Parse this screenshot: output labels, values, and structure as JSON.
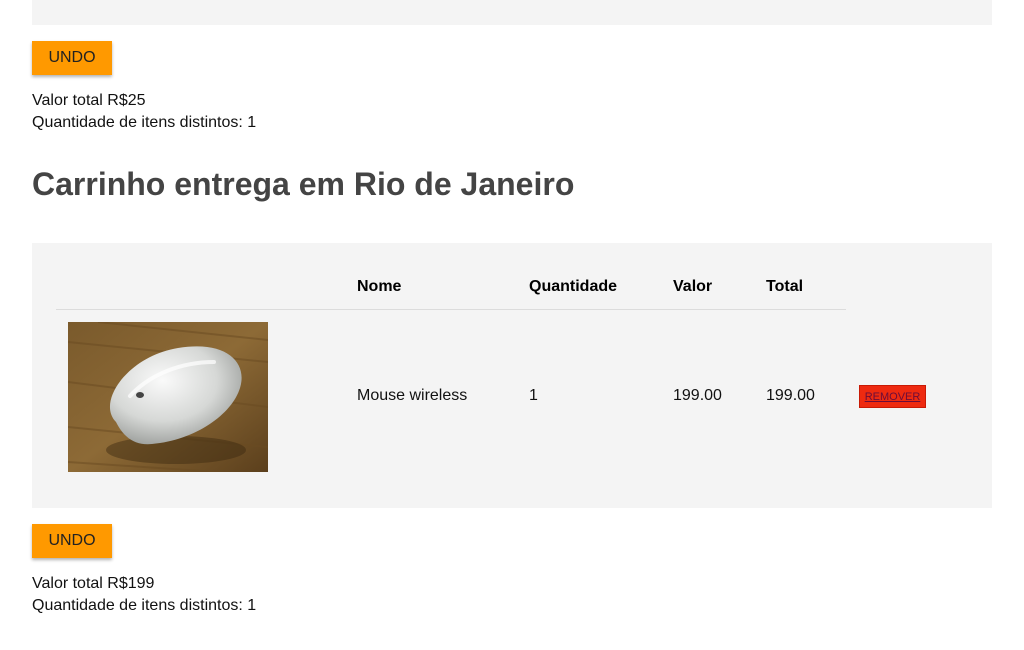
{
  "section_prev": {
    "undo_label": "UNDO",
    "total_line": "Valor total R$25",
    "distinct_line": "Quantidade de itens distintos: 1"
  },
  "cart": {
    "title": "Carrinho entrega em Rio de Janeiro",
    "columns": {
      "nome": "Nome",
      "quantidade": "Quantidade",
      "valor": "Valor",
      "total": "Total"
    },
    "items": [
      {
        "image": "mouse-photo",
        "nome": "Mouse wireless",
        "quantidade": "1",
        "valor": "199.00",
        "total": "199.00",
        "remove_label": "REMOVER"
      }
    ],
    "undo_label": "UNDO",
    "total_line": "Valor total R$199",
    "distinct_line": "Quantidade de itens distintos: 1"
  },
  "colors": {
    "undo": "#ff9900",
    "remove": "#ee2a10",
    "panel": "#f4f4f4"
  }
}
